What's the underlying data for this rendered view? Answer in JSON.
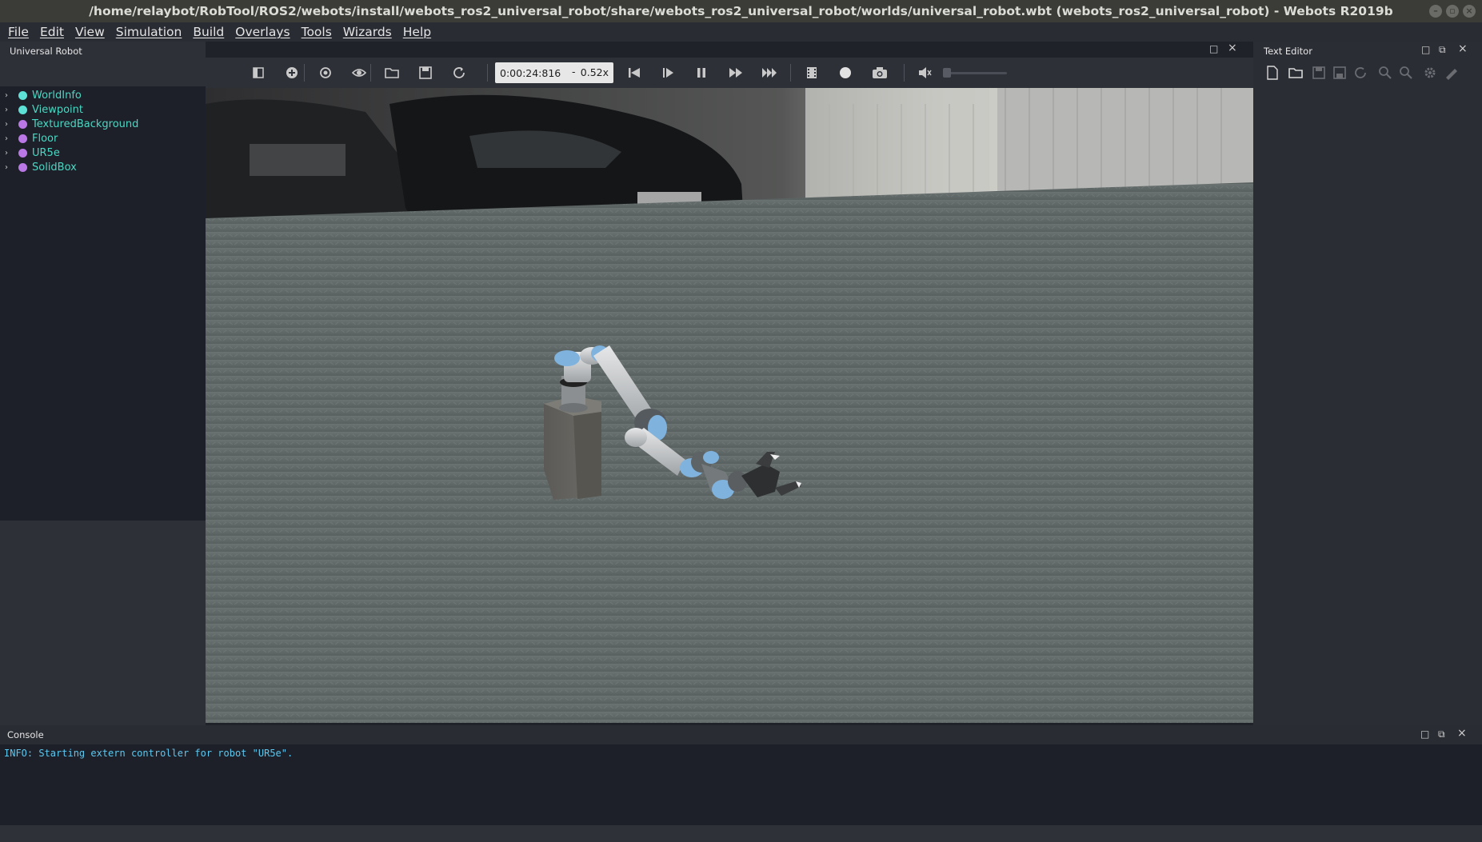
{
  "window": {
    "title": "/home/relaybot/RobTool/ROS2/webots/install/webots_ros2_universal_robot/share/webots_ros2_universal_robot/worlds/universal_robot.wbt (webots_ros2_universal_robot) - Webots R2019b"
  },
  "menu": [
    "File",
    "Edit",
    "View",
    "Simulation",
    "Build",
    "Overlays",
    "Tools",
    "Wizards",
    "Help"
  ],
  "scene_tree": {
    "title": "Universal Robot",
    "items": [
      {
        "label": "WorldInfo",
        "color": "#5de0d6"
      },
      {
        "label": "Viewpoint",
        "color": "#5de0d6"
      },
      {
        "label": "TexturedBackground",
        "color": "#b978e6"
      },
      {
        "label": "Floor",
        "color": "#b978e6"
      },
      {
        "label": "UR5e",
        "color": "#b978e6"
      },
      {
        "label": "SolidBox",
        "color": "#b978e6"
      }
    ]
  },
  "toolbar": {
    "time": "0:00:24:816",
    "separator": "-",
    "speed": "0.52x"
  },
  "text_editor": {
    "title": "Text Editor"
  },
  "console": {
    "title": "Console",
    "lines": [
      "INFO: Starting extern controller for robot \"UR5e\"."
    ]
  }
}
